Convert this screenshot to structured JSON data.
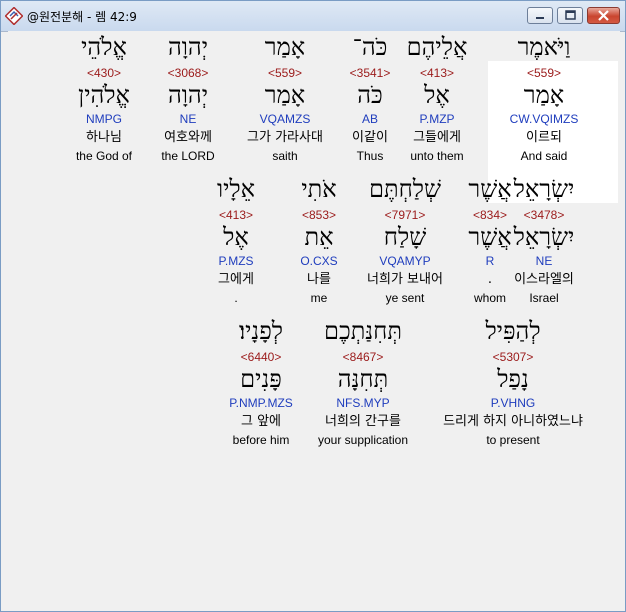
{
  "window": {
    "title": "@원전분해 - 렘 42:9",
    "icon": "app-diamond-icon"
  },
  "words": [
    {
      "hebrew": "וַיֹּאמֶר",
      "strong": "<559>",
      "lemma": "אָמַר",
      "parse": "CW.VQIMZS",
      "korean": "이르되",
      "english": "And said",
      "selected": true
    },
    {
      "hebrew": "אֲלֵיהֶם",
      "strong": "<413>",
      "lemma": "אֶל",
      "parse": "P.MZP",
      "korean": "그들에게",
      "english": "unto them"
    },
    {
      "hebrew": "כֹּה־",
      "strong": "<3541>",
      "lemma": "כֹּה",
      "parse": "AB",
      "korean": "이같이",
      "english": "Thus"
    },
    {
      "hebrew": "אָמַר",
      "strong": "<559>",
      "lemma": "אָמַר",
      "parse": "VQAMZS",
      "korean": "그가 가라사대",
      "english": "saith"
    },
    {
      "hebrew": "יְהוָה",
      "strong": "<3068>",
      "lemma": "יְהוָה",
      "parse": "NE",
      "korean": "여호와께",
      "english": "the LORD"
    },
    {
      "hebrew": "אֱלֹהֵי",
      "strong": "<430>",
      "lemma": "אֱלֹהִין",
      "parse": "NMPG",
      "korean": "하나님",
      "english": "the God of"
    },
    {
      "hebrew": "יִשְׂרָאֵל",
      "strong": "<3478>",
      "lemma": "יִשְׂרָאֵל",
      "parse": "NE",
      "korean": "이스라엘의",
      "english": "Israel"
    },
    {
      "hebrew": "אֲשֶׁר",
      "strong": "<834>",
      "lemma": "אֲשֶׁר",
      "parse": "R",
      "korean": ".",
      "english": "whom"
    },
    {
      "hebrew": "שְׁלַחְתֶּם",
      "strong": "<7971>",
      "lemma": "שָׁלַח",
      "parse": "VQAMYP",
      "korean": "너희가 보내어",
      "english": "ye sent"
    },
    {
      "hebrew": "אֹתִי",
      "strong": "<853>",
      "lemma": "אֵת",
      "parse": "O.CXS",
      "korean": "나를",
      "english": "me"
    },
    {
      "hebrew": "אֵלָיו",
      "strong": "<413>",
      "lemma": "אֶל",
      "parse": "P.MZS",
      "korean": "그에게",
      "english": "."
    },
    {
      "hebrew": "לְהַפִּיל",
      "strong": "<5307>",
      "lemma": "נָפַל",
      "parse": "P.VHNG",
      "korean": "드리게 하지 아니하였느냐",
      "english": "to present"
    },
    {
      "hebrew": "תְּחִנַּתְכֶם",
      "strong": "<8467>",
      "lemma": "תְּחִנָּה",
      "parse": "NFS.MYP",
      "korean": "너희의 간구를",
      "english": "your supplication"
    },
    {
      "hebrew": "לְפָנָיו׃",
      "strong": "<6440>",
      "lemma": "פָּנִים",
      "parse": "P.NMP.MZS",
      "korean": "그 앞에",
      "english": "before him"
    }
  ]
}
